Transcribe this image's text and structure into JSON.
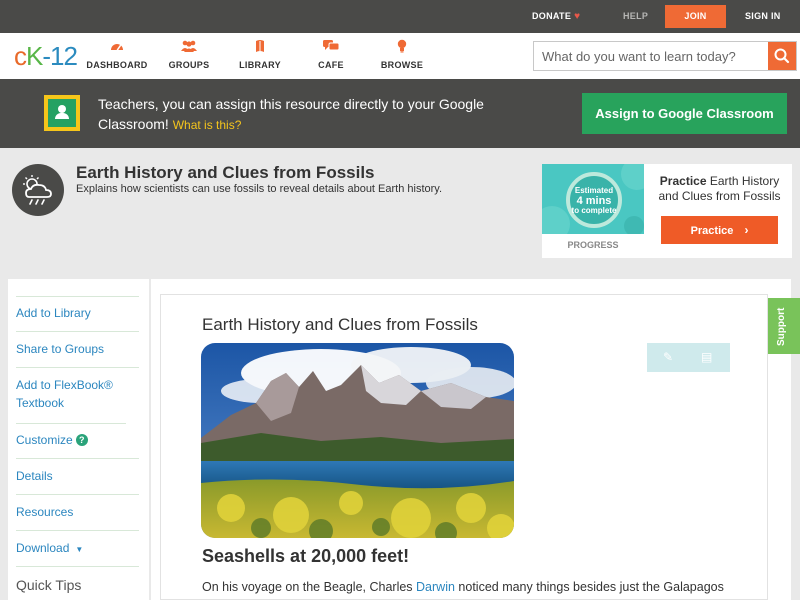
{
  "topbar": {
    "donate": "DONATE",
    "help": "HELP",
    "join": "JOIN",
    "signin": "SIGN IN"
  },
  "nav": {
    "logo_c": "c",
    "logo_k": "K",
    "logo_d": "-12",
    "items": [
      {
        "label": "DASHBOARD",
        "icon": "dashboard-icon"
      },
      {
        "label": "GROUPS",
        "icon": "groups-icon"
      },
      {
        "label": "LIBRARY",
        "icon": "library-icon"
      },
      {
        "label": "CAFE",
        "icon": "cafe-icon"
      },
      {
        "label": "BROWSE",
        "icon": "browse-icon"
      }
    ],
    "search_placeholder": "What do you want to learn today?"
  },
  "banner": {
    "text": "Teachers, you can assign this resource directly to your Google Classroom!",
    "whatis": "What is this?",
    "assign_button": "Assign to Google Classroom"
  },
  "header": {
    "title": "Earth History and Clues from Fossils",
    "subtitle": "Explains how scientists can use fossils to reveal details about Earth history."
  },
  "progress_card": {
    "estimated": "Estimated",
    "mins": "4 mins",
    "to_complete": "to complete",
    "progress_label": "PROGRESS",
    "practice_prefix": "Practice",
    "practice_title": "Earth History and Clues from Fossils",
    "practice_button": "Practice"
  },
  "sidebar": {
    "items": [
      {
        "label": "Add to Library"
      },
      {
        "label": "Share to Groups"
      },
      {
        "label": "Add to FlexBook® Textbook"
      },
      {
        "label": "Customize"
      },
      {
        "label": "Details"
      },
      {
        "label": "Resources"
      },
      {
        "label": "Download"
      }
    ],
    "quick_tips": "Quick Tips"
  },
  "content": {
    "title": "Earth History and Clues from Fossils",
    "subheading": "Seashells at 20,000 feet!",
    "para_before": "On his voyage on the Beagle, Charles ",
    "para_link": "Darwin",
    "para_after": " noticed many things besides just the Galapagos"
  },
  "support": "Support",
  "colors": {
    "accent_orange": "#ef6a35",
    "google_green": "#28a35c",
    "link_blue": "#2b86bf",
    "support_green": "#79c35a"
  }
}
